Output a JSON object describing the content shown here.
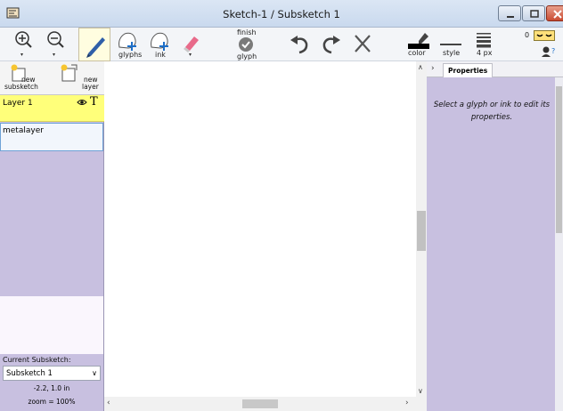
{
  "window": {
    "title": "Sketch-1 / Subsketch 1"
  },
  "toolbar": {
    "zoom_in_icon": "zoom-in-icon",
    "zoom_out_icon": "zoom-out-icon",
    "pen_icon": "pen-icon",
    "glyphs_label": "glyphs",
    "ink_label": "ink",
    "eraser_icon": "eraser-icon",
    "finish_glyph_label_1": "finish",
    "finish_glyph_label_2": "glyph",
    "color_label": "color",
    "style_label": "style",
    "stroke_size_label": "4 px",
    "stroke_count": "0",
    "colors": {
      "pen_color": "#000000",
      "pen_blue": "#2f5fa8",
      "eraser_pink": "#e86a8a",
      "check_gray": "#666666"
    }
  },
  "left_panel": {
    "new_subsketch_1": "new",
    "new_subsketch_2": "subsketch",
    "new_layer_1": "new",
    "new_layer_2": "layer",
    "layers": [
      {
        "name": "Layer 1",
        "visible_icon": "eye-icon",
        "text_icon": "T"
      },
      {
        "name": "metalayer"
      }
    ],
    "current_subsketch_label": "Current Subsketch:",
    "subsketch_value": "Subsketch 1",
    "coords": "-2.2, 1.0 in",
    "zoom": "zoom = 100%"
  },
  "properties": {
    "tab_label": "Properties",
    "message": "Select a glyph or ink to edit its properties."
  },
  "colors": {
    "panel_bg": "#c8c0e0",
    "layer_selected": "#ffff7a",
    "accent_border": "#6fa2d6"
  }
}
